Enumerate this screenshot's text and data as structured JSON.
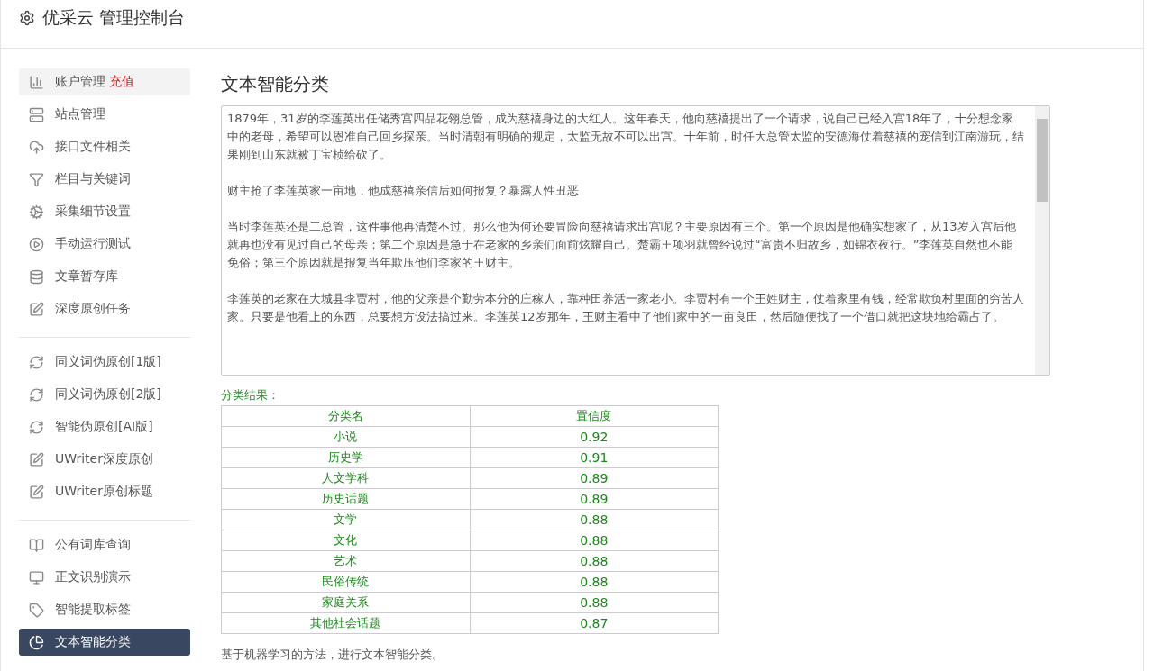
{
  "header": {
    "title": "优采云 管理控制台"
  },
  "sidebar": {
    "groups": [
      {
        "items": [
          {
            "label": "账户管理",
            "badge": "充值",
            "hovered": true,
            "selected": false
          },
          {
            "label": "站点管理",
            "hovered": false,
            "selected": false
          },
          {
            "label": "接口文件相关",
            "hovered": false,
            "selected": false
          },
          {
            "label": "栏目与关键词",
            "hovered": false,
            "selected": false
          },
          {
            "label": "采集细节设置",
            "hovered": false,
            "selected": false
          },
          {
            "label": "手动运行测试",
            "hovered": false,
            "selected": false
          },
          {
            "label": "文章暂存库",
            "hovered": false,
            "selected": false
          },
          {
            "label": "深度原创任务",
            "hovered": false,
            "selected": false
          }
        ]
      },
      {
        "items": [
          {
            "label": "同义词伪原创[1版]",
            "hovered": false,
            "selected": false
          },
          {
            "label": "同义词伪原创[2版]",
            "hovered": false,
            "selected": false
          },
          {
            "label": "智能伪原创[AI版]",
            "hovered": false,
            "selected": false
          },
          {
            "label": "UWriter深度原创",
            "hovered": false,
            "selected": false
          },
          {
            "label": "UWriter原创标题",
            "hovered": false,
            "selected": false
          }
        ]
      },
      {
        "items": [
          {
            "label": "公有词库查询",
            "hovered": false,
            "selected": false
          },
          {
            "label": "正文识别演示",
            "hovered": false,
            "selected": false
          },
          {
            "label": "智能提取标签",
            "hovered": false,
            "selected": false
          },
          {
            "label": "文本智能分类",
            "hovered": false,
            "selected": true
          }
        ]
      }
    ]
  },
  "main": {
    "title": "文本智能分类",
    "text_input": {
      "paragraphs": [
        "1879年，31岁的李莲英出任储秀宫四品花翎总管，成为慈禧身边的大红人。这年春天，他向慈禧提出了一个请求，说自己已经入宫18年了，十分想念家中的老母，希望可以恩准自己回乡探亲。当时清朝有明确的规定，太监无故不可以出宫。十年前，时任大总管太监的安德海仗着慈禧的宠信到江南游玩，结果刚到山东就被丁宝桢给砍了。",
        "财主抢了李莲英家一亩地，他成慈禧亲信后如何报复？暴露人性丑恶",
        "当时李莲英还是二总管，这件事他再清楚不过。那么他为何还要冒险向慈禧请求出宫呢？主要原因有三个。第一个原因是他确实想家了，从13岁入宫后他就再也没有见过自己的母亲；第二个原因是急于在老家的乡亲们面前炫耀自己。楚霸王项羽就曾经说过“富贵不归故乡，如锦衣夜行。”李莲英自然也不能免俗；第三个原因就是报复当年欺压他们李家的王财主。",
        "李莲英的老家在大城县李贾村，他的父亲是个勤劳本分的庄稼人，靠种田养活一家老小。李贾村有一个王姓财主，仗着家里有钱，经常欺负村里面的穷苦人家。只要是他看上的东西，总要想方设法搞过来。李莲英12岁那年，王财主看中了他们家中的一亩良田，然后随便找了一个借口就把这块地给霸占了。"
      ]
    },
    "result_label": "分类结果：",
    "table": {
      "columns": [
        "分类名",
        "置信度"
      ],
      "rows": [
        [
          "小说",
          "0.92"
        ],
        [
          "历史学",
          "0.91"
        ],
        [
          "人文学科",
          "0.89"
        ],
        [
          "历史话题",
          "0.89"
        ],
        [
          "文学",
          "0.88"
        ],
        [
          "文化",
          "0.88"
        ],
        [
          "艺术",
          "0.88"
        ],
        [
          "民俗传统",
          "0.88"
        ],
        [
          "家庭关系",
          "0.88"
        ],
        [
          "其他社会话题",
          "0.87"
        ]
      ]
    },
    "note": "基于机器学习的方法，进行文本智能分类。"
  }
}
